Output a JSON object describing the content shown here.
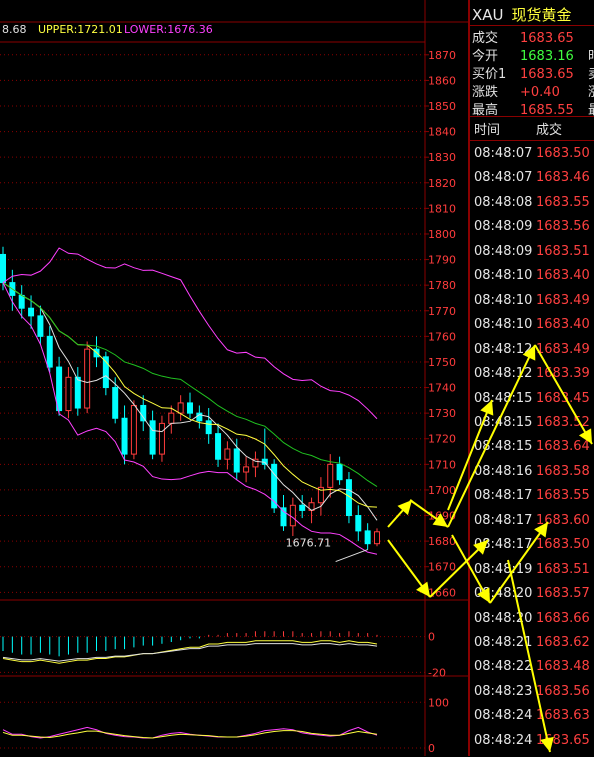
{
  "indicator": {
    "mid_partial": "8.68",
    "upper": "UPPER:1721.01",
    "lower": "LOWER:1676.36"
  },
  "colors": {
    "up": "#ff3c3c",
    "down": "#00ffff",
    "grid": "#8a0000",
    "axis_text": "#ff3c3c",
    "upper_band": "#ff40ff",
    "mid_band": "#e0e0e0",
    "ma_yellow": "#ffff40",
    "ma_green": "#20c020",
    "ma_blue": "#2040ff",
    "ma_gray": "#909090",
    "arrow": "#ffff00"
  },
  "chart_data": [
    {
      "type": "candlestick",
      "title": "",
      "y_ticks": [
        "1870",
        "1860",
        "1850",
        "1840",
        "1830",
        "1820",
        "1810",
        "1800",
        "1790",
        "1780",
        "1770",
        "1760",
        "1750",
        "1740",
        "1730",
        "1720",
        "1710",
        "1700",
        "1690",
        "1680",
        "1670",
        "1660"
      ],
      "ylim": [
        1657,
        1875
      ],
      "annotation": "1676.71",
      "candles": [
        [
          1792,
          1795,
          1778,
          1781
        ],
        [
          1781,
          1786,
          1770,
          1776
        ],
        [
          1776,
          1780,
          1767,
          1771
        ],
        [
          1771,
          1776,
          1763,
          1768
        ],
        [
          1768,
          1772,
          1757,
          1760
        ],
        [
          1760,
          1764,
          1746,
          1748
        ],
        [
          1748,
          1752,
          1729,
          1731
        ],
        [
          1731,
          1748,
          1728,
          1744
        ],
        [
          1744,
          1748,
          1729,
          1732
        ],
        [
          1732,
          1758,
          1730,
          1755
        ],
        [
          1755,
          1760,
          1748,
          1752
        ],
        [
          1752,
          1754,
          1737,
          1740
        ],
        [
          1740,
          1744,
          1726,
          1728
        ],
        [
          1728,
          1733,
          1710,
          1714
        ],
        [
          1714,
          1735,
          1712,
          1733
        ],
        [
          1733,
          1737,
          1723,
          1727
        ],
        [
          1727,
          1731,
          1712,
          1714
        ],
        [
          1714,
          1729,
          1711,
          1726
        ],
        [
          1726,
          1733,
          1722,
          1730
        ],
        [
          1730,
          1737,
          1727,
          1734
        ],
        [
          1734,
          1738,
          1728,
          1730
        ],
        [
          1730,
          1733,
          1724,
          1727
        ],
        [
          1727,
          1732,
          1718,
          1722
        ],
        [
          1722,
          1726,
          1709,
          1712
        ],
        [
          1712,
          1719,
          1708,
          1716
        ],
        [
          1716,
          1720,
          1704,
          1707
        ],
        [
          1707,
          1713,
          1703,
          1709
        ],
        [
          1709,
          1715,
          1705,
          1712
        ],
        [
          1712,
          1724,
          1708,
          1710
        ],
        [
          1710,
          1712,
          1691,
          1693
        ],
        [
          1693,
          1698,
          1684,
          1686
        ],
        [
          1686,
          1697,
          1682,
          1694
        ],
        [
          1694,
          1698,
          1689,
          1692
        ],
        [
          1692,
          1697,
          1687,
          1695
        ],
        [
          1695,
          1705,
          1690,
          1701
        ],
        [
          1701,
          1714,
          1697,
          1710
        ],
        [
          1710,
          1713,
          1702,
          1704
        ],
        [
          1704,
          1707,
          1687,
          1690
        ],
        [
          1690,
          1694,
          1680,
          1684
        ],
        [
          1684,
          1687,
          1676.71,
          1679
        ],
        [
          1679,
          1685,
          1678,
          1683.65
        ]
      ]
    },
    {
      "type": "bar",
      "title": "",
      "y_ticks": [
        "0",
        "-20"
      ],
      "ylim": [
        -22,
        16
      ],
      "values": [
        -8,
        -9,
        -10,
        -10,
        -9,
        -10,
        -11,
        -10,
        -9,
        -9,
        -8,
        -8,
        -7,
        -7,
        -6,
        -5,
        -5,
        -4,
        -3,
        -2,
        -1,
        -1,
        1,
        1,
        2,
        2,
        2,
        3,
        3,
        3,
        3,
        3,
        2,
        2,
        3,
        3,
        2,
        3,
        2,
        2,
        1
      ]
    },
    {
      "type": "line",
      "title": "",
      "y_ticks": [
        "100",
        "0"
      ],
      "ylim": [
        0,
        105
      ],
      "series": [
        {
          "values": [
            40,
            30,
            30,
            25,
            22,
            25,
            30,
            35,
            40,
            45,
            40,
            32,
            28,
            25,
            24,
            22,
            22,
            28,
            32,
            34,
            30,
            28,
            26,
            24,
            24,
            24,
            28,
            32,
            38,
            40,
            42,
            40,
            33,
            30,
            28,
            26,
            28,
            38,
            45,
            35,
            28
          ]
        },
        {
          "values": [
            34,
            28,
            28,
            26,
            24,
            23,
            26,
            30,
            33,
            37,
            37,
            33,
            30,
            27,
            25,
            23,
            22,
            25,
            28,
            30,
            29,
            28,
            27,
            25,
            24,
            24,
            26,
            29,
            33,
            36,
            38,
            38,
            36,
            32,
            30,
            28,
            28,
            32,
            36,
            33,
            30
          ]
        }
      ]
    }
  ],
  "quote": {
    "symbol": "XAU",
    "name": "现货黄金",
    "rows": [
      {
        "label": "成交",
        "value": "1683.65",
        "color": "#ff4040",
        "extra": ""
      },
      {
        "label": "今开",
        "value": "1683.16",
        "color": "#40ff40",
        "extra": "时"
      },
      {
        "label": "买价1",
        "value": "1683.65",
        "color": "#ff4040",
        "extra": "卖"
      },
      {
        "label": "涨跌",
        "value": "+0.40",
        "color": "#ff4040",
        "extra": "涨"
      },
      {
        "label": "最高",
        "value": "1685.55",
        "color": "#ff4040",
        "extra": "最"
      }
    ]
  },
  "ticks": {
    "header_time": "时间",
    "header_price": "成交",
    "rows": [
      {
        "time": "08:48:07",
        "price": "1683.50"
      },
      {
        "time": "08:48:07",
        "price": "1683.46"
      },
      {
        "time": "08:48:08",
        "price": "1683.55"
      },
      {
        "time": "08:48:09",
        "price": "1683.56"
      },
      {
        "time": "08:48:09",
        "price": "1683.51"
      },
      {
        "time": "08:48:10",
        "price": "1683.40"
      },
      {
        "time": "08:48:10",
        "price": "1683.49"
      },
      {
        "time": "08:48:10",
        "price": "1683.40"
      },
      {
        "time": "08:48:12",
        "price": "1683.49"
      },
      {
        "time": "08:48:12",
        "price": "1683.39"
      },
      {
        "time": "08:48:15",
        "price": "1683.45"
      },
      {
        "time": "08:48:15",
        "price": "1683.52"
      },
      {
        "time": "08:48:15",
        "price": "1683.64"
      },
      {
        "time": "08:48:16",
        "price": "1683.58"
      },
      {
        "time": "08:48:17",
        "price": "1683.55"
      },
      {
        "time": "08:48:17",
        "price": "1683.60"
      },
      {
        "time": "08:48:17",
        "price": "1683.50"
      },
      {
        "time": "08:48:19",
        "price": "1683.51"
      },
      {
        "time": "08:48:20",
        "price": "1683.57"
      },
      {
        "time": "08:48:20",
        "price": "1683.66"
      },
      {
        "time": "08:48:21",
        "price": "1683.62"
      },
      {
        "time": "08:48:22",
        "price": "1683.48"
      },
      {
        "time": "08:48:23",
        "price": "1683.56"
      },
      {
        "time": "08:48:24",
        "price": "1683.63"
      },
      {
        "time": "08:48:24",
        "price": "1683.65"
      }
    ]
  }
}
